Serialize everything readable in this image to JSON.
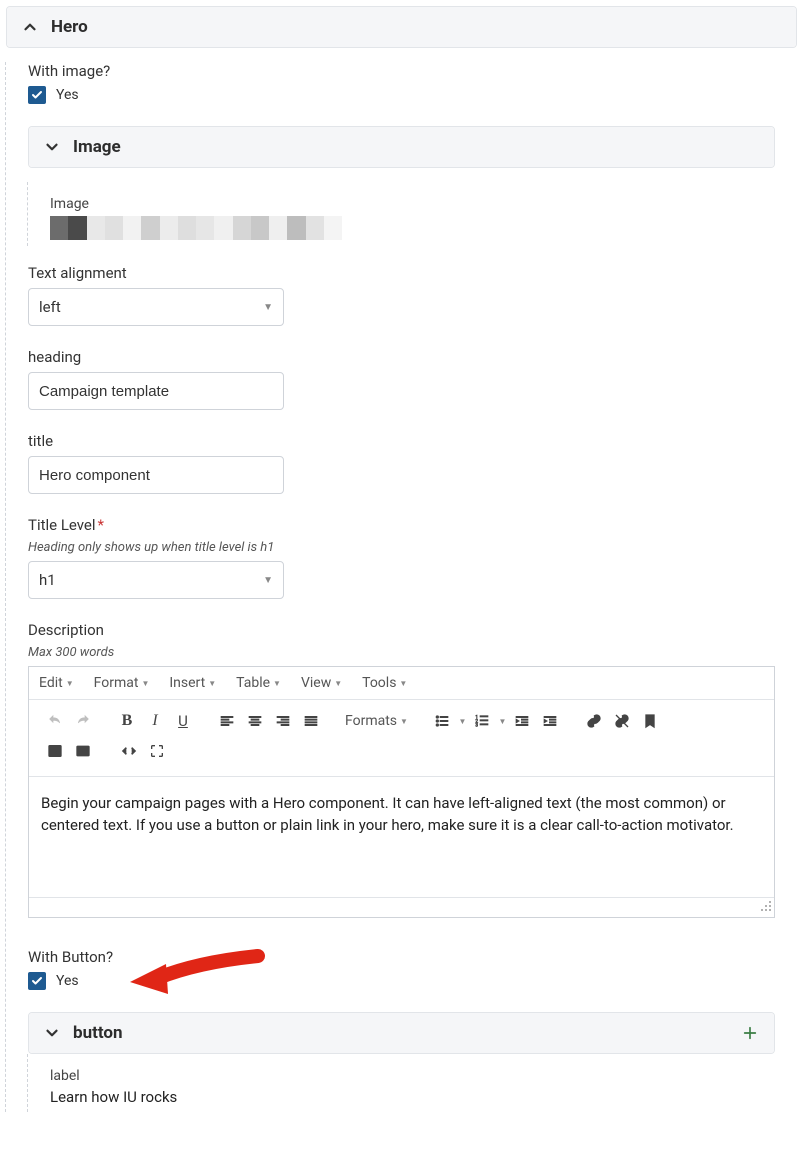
{
  "hero": {
    "title": "Hero",
    "withImage": {
      "label": "With image?",
      "yes": "Yes"
    },
    "imageSection": {
      "title": "Image",
      "fieldLabel": "Image"
    },
    "textAlign": {
      "label": "Text alignment",
      "value": "left"
    },
    "heading": {
      "label": "heading",
      "value": "Campaign template"
    },
    "titleField": {
      "label": "title",
      "value": "Hero component"
    },
    "titleLevel": {
      "label": "Title Level",
      "required": "*",
      "help": "Heading only shows up when title level is h1",
      "value": "h1"
    },
    "description": {
      "label": "Description",
      "help": "Max 300 words",
      "menus": {
        "edit": "Edit",
        "format": "Format",
        "insert": "Insert",
        "table": "Table",
        "view": "View",
        "tools": "Tools"
      },
      "formatsLabel": "Formats",
      "content": "Begin your campaign pages with a Hero component. It can have left-aligned text (the most common) or centered text. If you use a button or plain link in your hero, make sure it is a clear call-to-action motivator."
    },
    "withButton": {
      "label": "With Button?",
      "yes": "Yes"
    },
    "buttonSection": {
      "title": "button",
      "label": "label",
      "value": "Learn how IU rocks"
    }
  }
}
